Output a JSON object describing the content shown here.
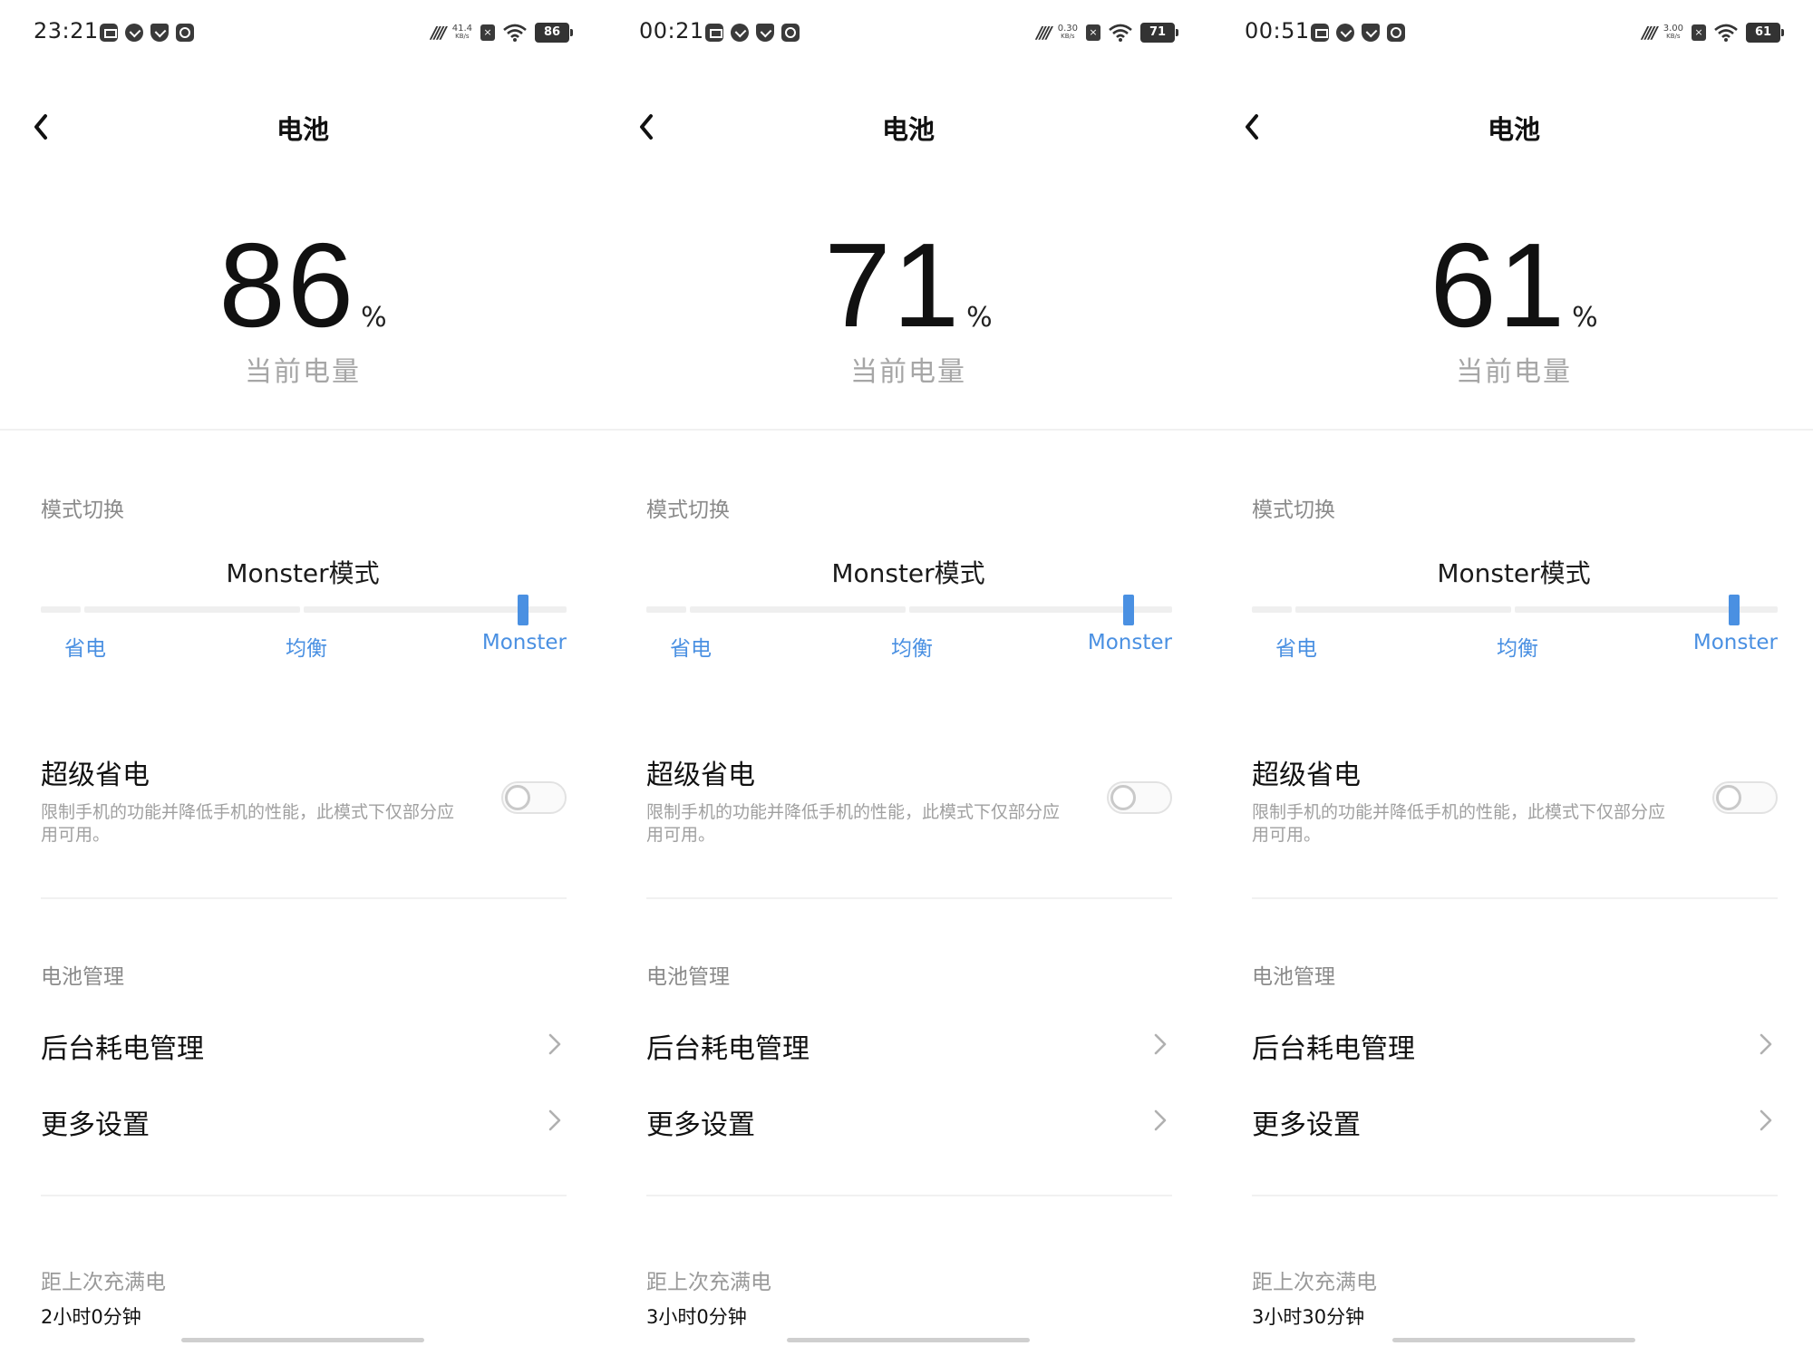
{
  "screens": [
    {
      "status": {
        "time": "23:21",
        "speed_value": "41.4",
        "speed_unit": "KB/s",
        "battery": "86"
      },
      "title": "电池",
      "level": {
        "number": "86",
        "unit": "%",
        "label": "当前电量"
      },
      "mode": {
        "section": "模式切换",
        "current": "Monster模式",
        "options": [
          "省电",
          "均衡",
          "Monster"
        ],
        "selected_index": 2
      },
      "super_saver": {
        "title": "超级省电",
        "description": "限制手机的功能并降低手机的性能，此模式下仅部分应用可用。",
        "enabled": false
      },
      "management": {
        "section": "电池管理",
        "items": [
          "后台耗电管理",
          "更多设置"
        ]
      },
      "since_full": {
        "label": "距上次充满电",
        "value": "2小时0分钟"
      }
    },
    {
      "status": {
        "time": "00:21",
        "speed_value": "0.30",
        "speed_unit": "KB/s",
        "battery": "71"
      },
      "title": "电池",
      "level": {
        "number": "71",
        "unit": "%",
        "label": "当前电量"
      },
      "mode": {
        "section": "模式切换",
        "current": "Monster模式",
        "options": [
          "省电",
          "均衡",
          "Monster"
        ],
        "selected_index": 2
      },
      "super_saver": {
        "title": "超级省电",
        "description": "限制手机的功能并降低手机的性能，此模式下仅部分应用可用。",
        "enabled": false
      },
      "management": {
        "section": "电池管理",
        "items": [
          "后台耗电管理",
          "更多设置"
        ]
      },
      "since_full": {
        "label": "距上次充满电",
        "value": "3小时0分钟"
      }
    },
    {
      "status": {
        "time": "00:51",
        "speed_value": "3.00",
        "speed_unit": "KB/s",
        "battery": "61"
      },
      "title": "电池",
      "level": {
        "number": "61",
        "unit": "%",
        "label": "当前电量"
      },
      "mode": {
        "section": "模式切换",
        "current": "Monster模式",
        "options": [
          "省电",
          "均衡",
          "Monster"
        ],
        "selected_index": 2
      },
      "super_saver": {
        "title": "超级省电",
        "description": "限制手机的功能并降低手机的性能，此模式下仅部分应用可用。",
        "enabled": false
      },
      "management": {
        "section": "电池管理",
        "items": [
          "后台耗电管理",
          "更多设置"
        ]
      },
      "since_full": {
        "label": "距上次充满电",
        "value": "3小时30分钟"
      }
    }
  ],
  "colors": {
    "accent": "#4a90e2",
    "muted_text": "#a6a6a6",
    "divider": "#f1f1f1"
  },
  "icons": {
    "back": "chevron-left-icon",
    "row": "chevron-right-icon",
    "wifi": "wifi-icon",
    "battery": "battery-icon"
  }
}
